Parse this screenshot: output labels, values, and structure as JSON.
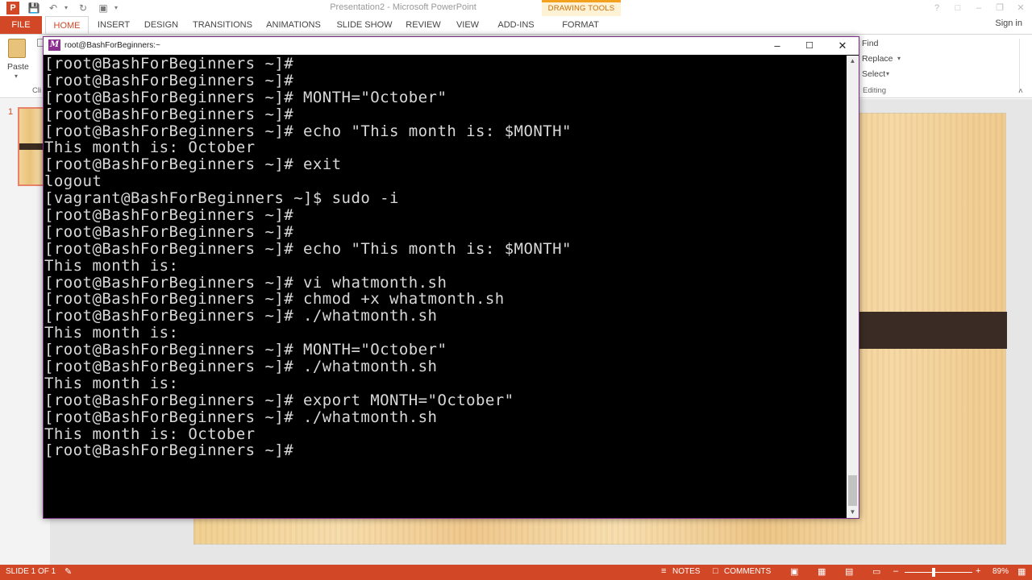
{
  "ppt": {
    "window_title": "Presentation2 - Microsoft PowerPoint",
    "contextual_group": "DRAWING TOOLS",
    "qat": {
      "save_icon": "save-icon",
      "undo_icon": "undo-icon",
      "redo_icon": "redo-icon",
      "present_icon": "present-icon"
    },
    "tabs": {
      "file": "FILE",
      "home": "HOME",
      "insert": "INSERT",
      "design": "DESIGN",
      "transitions": "TRANSITIONS",
      "animations": "ANIMATIONS",
      "slideshow": "SLIDE SHOW",
      "review": "REVIEW",
      "view": "VIEW",
      "addins": "ADD-INS",
      "format": "FORMAT"
    },
    "sign_in": "Sign in",
    "ribbon": {
      "paste": "Paste",
      "clipboard": "Cli",
      "find": "Find",
      "replace": "Replace",
      "select": "Select",
      "editing": "Editing"
    },
    "slide_number": "1",
    "status": {
      "slide": "SLIDE 1 OF 1",
      "notes": "NOTES",
      "comments": "COMMENTS",
      "zoom": "89%"
    },
    "colors": {
      "accent": "#d24726",
      "contextual": "#f3a21f"
    }
  },
  "terminal": {
    "title": "root@BashForBeginners:~",
    "lines": [
      "[root@BashForBeginners ~]#",
      "[root@BashForBeginners ~]#",
      "[root@BashForBeginners ~]# MONTH=\"October\"",
      "[root@BashForBeginners ~]#",
      "[root@BashForBeginners ~]# echo \"This month is: $MONTH\"",
      "This month is: October",
      "[root@BashForBeginners ~]# exit",
      "logout",
      "[vagrant@BashForBeginners ~]$ sudo -i",
      "[root@BashForBeginners ~]#",
      "[root@BashForBeginners ~]#",
      "[root@BashForBeginners ~]# echo \"This month is: $MONTH\"",
      "This month is:",
      "[root@BashForBeginners ~]# vi whatmonth.sh",
      "[root@BashForBeginners ~]# chmod +x whatmonth.sh",
      "[root@BashForBeginners ~]# ./whatmonth.sh",
      "This month is:",
      "[root@BashForBeginners ~]# MONTH=\"October\"",
      "[root@BashForBeginners ~]# ./whatmonth.sh",
      "This month is:",
      "[root@BashForBeginners ~]# export MONTH=\"October\"",
      "[root@BashForBeginners ~]# ./whatmonth.sh",
      "This month is: October",
      "[root@BashForBeginners ~]#"
    ]
  }
}
